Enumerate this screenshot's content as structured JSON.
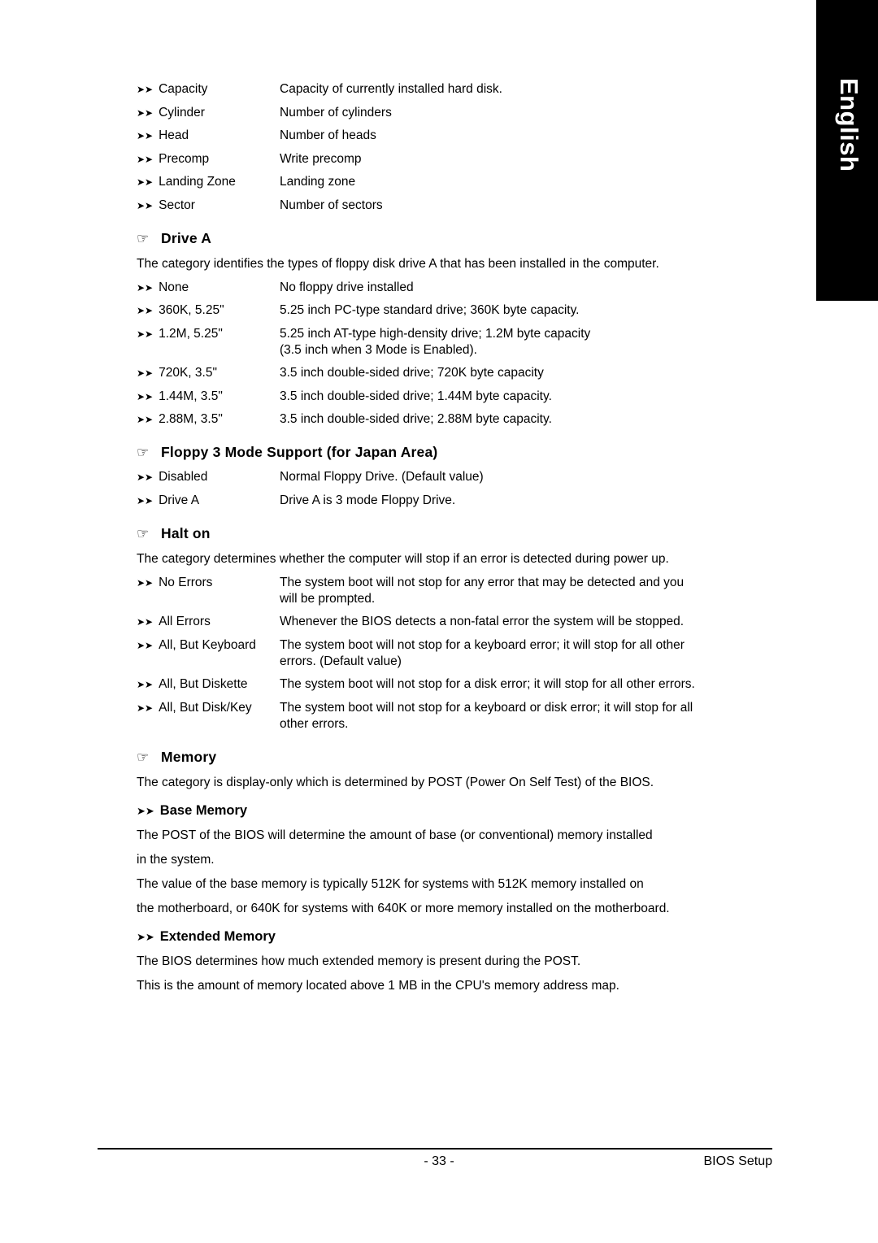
{
  "sidebar": {
    "language_label": "English"
  },
  "bullets": {
    "double_arrow": "➤➤",
    "hand": "☞"
  },
  "top_definitions": [
    {
      "term": "Capacity",
      "desc": "Capacity of currently installed hard disk."
    },
    {
      "term": "Cylinder",
      "desc": "Number of cylinders"
    },
    {
      "term": "Head",
      "desc": "Number of heads"
    },
    {
      "term": "Precomp",
      "desc": "Write precomp"
    },
    {
      "term": "Landing Zone",
      "desc": "Landing zone"
    },
    {
      "term": "Sector",
      "desc": "Number of sectors"
    }
  ],
  "sections": [
    {
      "title": "Drive A",
      "paragraph": "The category identifies the types of floppy disk drive A that has been installed in the computer.",
      "items": [
        {
          "term": "None",
          "desc": "No floppy drive installed",
          "cont": ""
        },
        {
          "term": "360K, 5.25\"",
          "desc": "5.25 inch PC-type standard drive; 360K byte capacity.",
          "cont": ""
        },
        {
          "term": "1.2M, 5.25\"",
          "desc": "5.25 inch AT-type high-density drive; 1.2M byte capacity",
          "cont": "(3.5 inch when 3 Mode is Enabled)."
        },
        {
          "term": "720K, 3.5\"",
          "desc": "3.5 inch double-sided drive; 720K byte capacity",
          "cont": ""
        },
        {
          "term": "1.44M, 3.5\"",
          "desc": "3.5 inch double-sided drive; 1.44M byte capacity.",
          "cont": ""
        },
        {
          "term": "2.88M, 3.5\"",
          "desc": "3.5 inch double-sided drive; 2.88M byte capacity.",
          "cont": ""
        }
      ]
    },
    {
      "title": "Floppy 3 Mode Support (for Japan Area)",
      "paragraph": "",
      "items": [
        {
          "term": "Disabled",
          "desc": "Normal Floppy Drive. (Default value)",
          "cont": ""
        },
        {
          "term": "Drive A",
          "desc": "Drive A is 3 mode Floppy Drive.",
          "cont": ""
        }
      ]
    },
    {
      "title": "Halt on",
      "paragraph": "The category determines whether the computer will stop if an error is detected during power up.",
      "items": [
        {
          "term": "No Errors",
          "desc": "The system boot will not stop for any error that may be detected and  you",
          "cont": "will be prompted."
        },
        {
          "term": "All Errors",
          "desc": "Whenever the BIOS detects a non-fatal error the system will be stopped.",
          "cont": ""
        },
        {
          "term": "All, But Keyboard",
          "desc": "The system boot will not stop for a keyboard error; it will stop for all other",
          "cont": "errors. (Default value)"
        },
        {
          "term": "All, But Diskette",
          "desc": "The system boot will not stop for a disk error; it will stop for all other errors.",
          "cont": ""
        },
        {
          "term": "All, But Disk/Key",
          "desc": "The system boot will not stop for a keyboard or disk error; it will stop for all",
          "cont": "other errors."
        }
      ]
    }
  ],
  "memory_section": {
    "title": "Memory",
    "paragraph": "The category is display-only which is determined by POST (Power On Self Test) of the BIOS.",
    "base_memory": {
      "title": "Base Memory",
      "paragraphs": [
        "The POST of the BIOS will determine the amount of base (or conventional) memory installed",
        "in the system.",
        "The value of the base memory is typically 512K for systems with 512K memory installed on",
        "the motherboard, or 640K for systems with 640K or more memory installed on the motherboard."
      ]
    },
    "extended_memory": {
      "title": "Extended Memory",
      "paragraphs": [
        "The BIOS determines how much extended memory is present during the POST.",
        "This is the amount of memory located above 1 MB in the CPU's memory address map."
      ]
    }
  },
  "footer": {
    "page_number": "- 33 -",
    "section_label": "BIOS Setup"
  }
}
